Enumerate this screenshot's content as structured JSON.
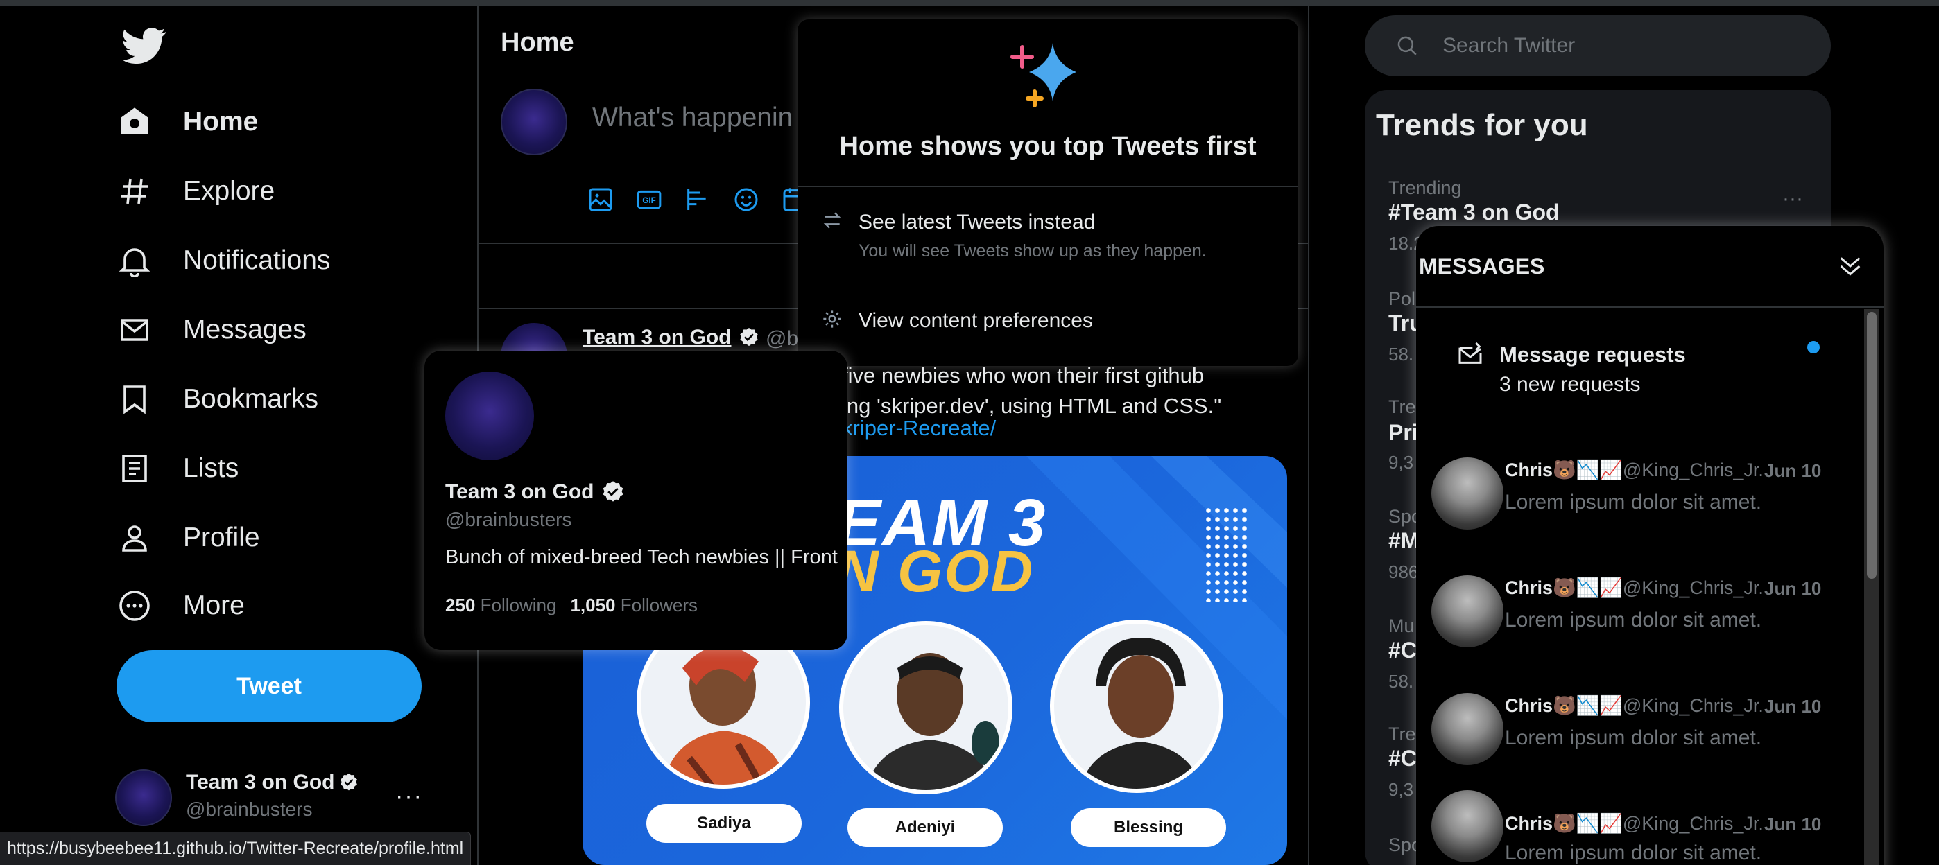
{
  "nav": {
    "items": [
      {
        "label": "Home",
        "icon": "home-icon",
        "active": true
      },
      {
        "label": "Explore",
        "icon": "hashtag-icon"
      },
      {
        "label": "Notifications",
        "icon": "bell-icon"
      },
      {
        "label": "Messages",
        "icon": "envelope-icon"
      },
      {
        "label": "Bookmarks",
        "icon": "bookmark-icon"
      },
      {
        "label": "Lists",
        "icon": "list-icon"
      },
      {
        "label": "Profile",
        "icon": "person-icon"
      },
      {
        "label": "More",
        "icon": "more-circle-icon"
      }
    ],
    "tweet_button": "Tweet",
    "account": {
      "name": "Team 3 on God",
      "handle": "@brainbusters",
      "more": "···"
    }
  },
  "status_url": "https://busybeebee11.github.io/Twitter-Recreate/profile.html",
  "home": {
    "title": "Home",
    "compose_placeholder": "What's happenin",
    "tweet": {
      "author": "Team 3 on God",
      "handle_partial": "@br",
      "text_line1": "five newbies who won their first github",
      "text_line2": "ing 'skriper.dev', using HTML and CSS.\"",
      "link": "kriper-Recreate/",
      "image": {
        "title_line1": "EAM 3",
        "title_line2": "N GOD",
        "people": [
          "Sadiya",
          "Adeniyi",
          "Blessing"
        ]
      }
    }
  },
  "top_tweets_popup": {
    "title": "Home shows you top Tweets first",
    "option1_title": "See latest Tweets instead",
    "option1_sub": "You will see Tweets show up as they happen.",
    "option2_title": "View content preferences"
  },
  "hover_card": {
    "name": "Team 3 on God",
    "handle": "@brainbusters",
    "bio": "Bunch of mixed-breed Tech newbies || Front",
    "following_count": "250",
    "following_label": "Following",
    "followers_count": "1,050",
    "followers_label": "Followers"
  },
  "search": {
    "placeholder": "Search Twitter"
  },
  "trends": {
    "title": "Trends for you",
    "first": {
      "category": "Trending",
      "name": "#Team 3 on God",
      "count": "18.2"
    },
    "partial": [
      {
        "category": "Pol",
        "name": "Tru",
        "count": "58."
      },
      {
        "category": "Tre",
        "name": "Pri",
        "count": "9,3"
      },
      {
        "category": "Spo",
        "name": "#M",
        "count": "986"
      },
      {
        "category": "Mu",
        "name": "#C",
        "count": "58."
      },
      {
        "category": "Tre",
        "name": "#C",
        "count": "9,3"
      },
      {
        "category": "Spo",
        "name": "",
        "count": ""
      }
    ],
    "more": "···"
  },
  "messages": {
    "title": "MESSAGES",
    "requests_title": "Message requests",
    "requests_sub": "3 new requests",
    "conversations": [
      {
        "name": "Chris🐻📉📈",
        "handle": "@King_Chris_Jr.",
        "date": "Jun 10",
        "text": "Lorem ipsum dolor sit amet."
      },
      {
        "name": "Chris🐻📉📈",
        "handle": "@King_Chris_Jr.",
        "date": "Jun 10",
        "text": "Lorem ipsum dolor sit amet."
      },
      {
        "name": "Chris🐻📉📈",
        "handle": "@King_Chris_Jr.",
        "date": "Jun 10",
        "text": "Lorem ipsum dolor sit amet."
      },
      {
        "name": "Chris🐻📉📈",
        "handle": "@King_Chris_Jr.",
        "date": "Jun 10",
        "text": "Lorem ipsum dolor sit amet."
      }
    ]
  },
  "colors": {
    "accent": "#1d9bf0",
    "background": "#000000",
    "muted": "#71767b",
    "text": "#e7e9ea"
  }
}
